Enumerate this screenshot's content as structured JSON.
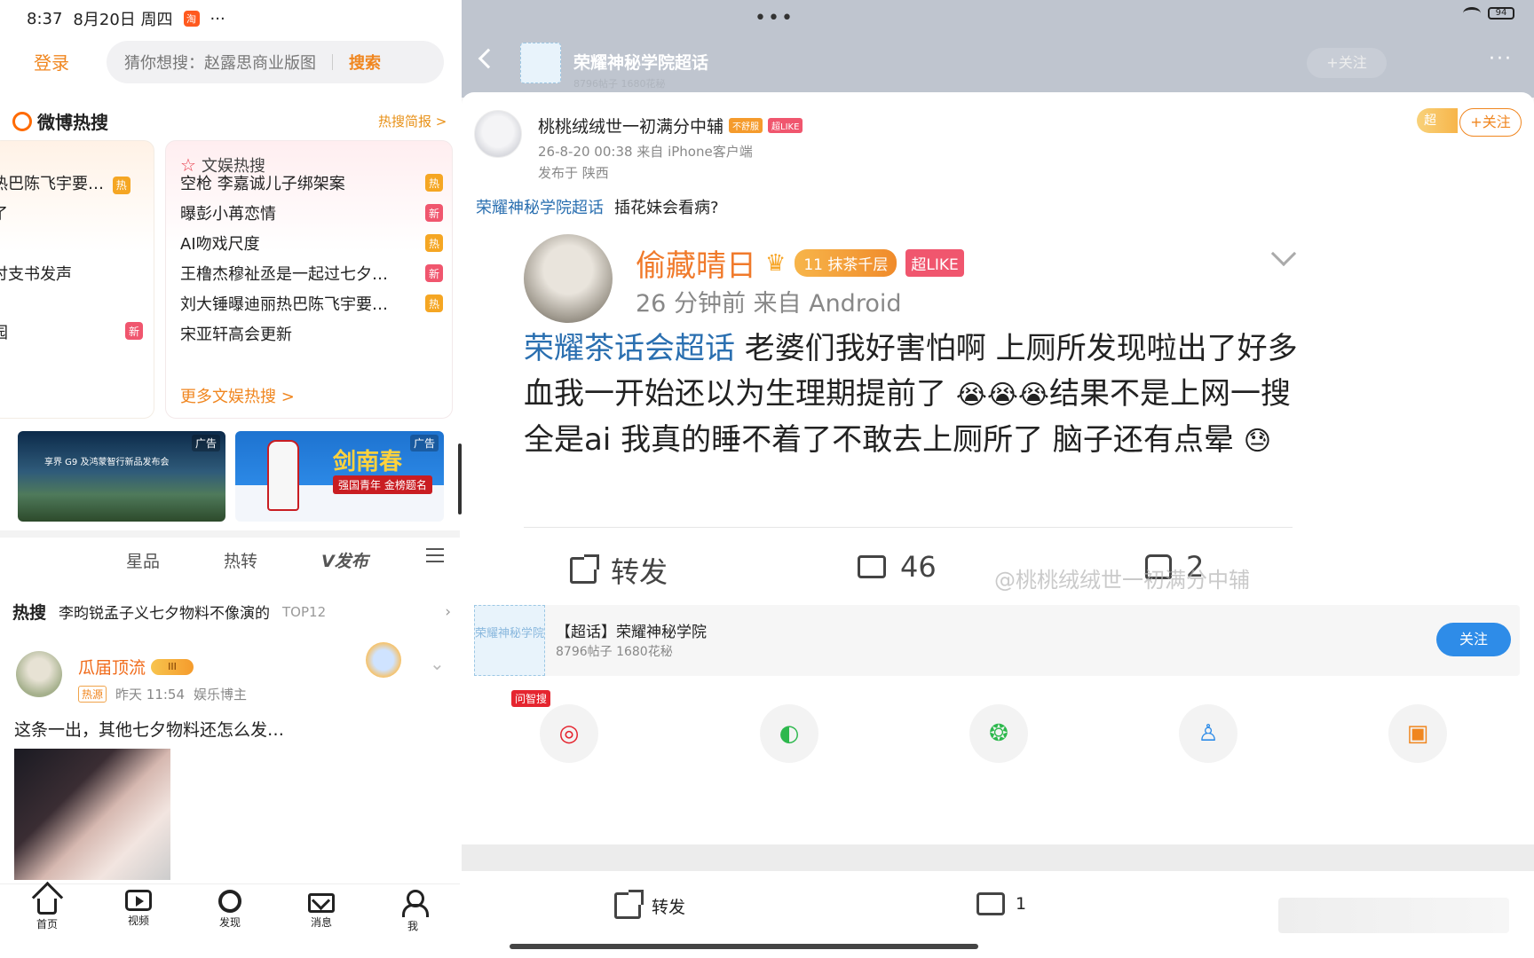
{
  "left": {
    "status": {
      "time": "8:37",
      "date": "8月20日 周四",
      "app_badge": "淘",
      "more": "···"
    },
    "login": "登录",
    "search": {
      "placeholder": "猜你想搜：赵露思商业版图",
      "button": "搜索"
    },
    "hot": {
      "title": "微博热搜",
      "brief": "热搜简报 >",
      "left_rows": [
        {
          "text": "热巴陈飞宇要…",
          "tag": "热"
        },
        {
          "text": "了",
          "tag": ""
        },
        {
          "text": "",
          "tag": ""
        },
        {
          "text": "讨支书发声",
          "tag": ""
        },
        {
          "text": "",
          "tag": ""
        },
        {
          "text": "园",
          "tag": "新"
        }
      ],
      "ent": {
        "title": "文娱热搜",
        "rows": [
          {
            "text": "空枪 李嘉诚儿子绑架案",
            "tag": "热"
          },
          {
            "text": "曝彭小苒恋情",
            "tag": "新"
          },
          {
            "text": "AI吻戏尺度",
            "tag": "热"
          },
          {
            "text": "王橹杰穆祉丞是一起过七夕…",
            "tag": "新"
          },
          {
            "text": "刘大锤曝迪丽热巴陈飞宇要…",
            "tag": "热"
          },
          {
            "text": "宋亚轩高会更新",
            "tag": ""
          }
        ],
        "more": "更多文娱热搜 >"
      }
    },
    "ads": [
      {
        "label": "广告",
        "text": "享界 G9 及鸿蒙智行新品发布会"
      },
      {
        "label": "广告",
        "brand": "剑南春",
        "slogan": "强国青年 金榜题名"
      }
    ],
    "tabs": [
      "星品",
      "热转",
      "V发布"
    ],
    "hotline": {
      "prefix": "热搜",
      "text": "李昀锐孟子义七夕物料不像演的",
      "rank": "TOP12"
    },
    "post": {
      "name": "瓜届顶流",
      "vip": "III",
      "source_tag": "热源",
      "time": "昨天 11:54",
      "role": "娱乐博主",
      "text": "这条一出，其他七夕物料还怎么发…"
    },
    "nav": [
      "首页",
      "视频",
      "发现",
      "消息",
      "我"
    ]
  },
  "right": {
    "status": {
      "dots": "•••",
      "battery": "94"
    },
    "header": {
      "title": "荣耀神秘学院超话",
      "subtitle": "8796帖子 1680花秘",
      "follow": "+关注",
      "more": "···"
    },
    "author": {
      "name": "桃桃绒绒世一初满分中辅",
      "badge1": "不舒服",
      "badge2": "超LIKE",
      "meta": "26-8-20 00:38  来自 iPhone客户端",
      "location": "发布于 陕西",
      "super_tag": "超",
      "follow": "+关注"
    },
    "repost": {
      "topic": "荣耀神秘学院超话",
      "text": "插花妹会看病?"
    },
    "original": {
      "name": "偷藏晴日",
      "level": "11 抹茶千层",
      "like_badge": "超LIKE",
      "meta": "26 分钟前  来自 Android",
      "topic": "荣耀茶话会超话",
      "text1": " 老婆们我好害怕啊 上厕所发现啦出了好多血我一开始还以为生理期提前了 ",
      "emoji1": "😭😭😭",
      "text2": "结果不是上网一搜全是ai 我真的睡不着了不敢去上厕所了 脑子还有点晕 ",
      "emoji2": "😓",
      "share": "转发",
      "comments": "46",
      "likes": "2"
    },
    "watermark": "@桃桃绒绒世一初满分中辅",
    "supercard": {
      "logo": "荣耀神秘学院",
      "name": "【超话】荣耀神秘学院",
      "count": "8796帖子 1680花秘",
      "follow": "关注"
    },
    "share_badge": "问智搜",
    "bottom": {
      "share": "转发",
      "comments": "1"
    }
  }
}
